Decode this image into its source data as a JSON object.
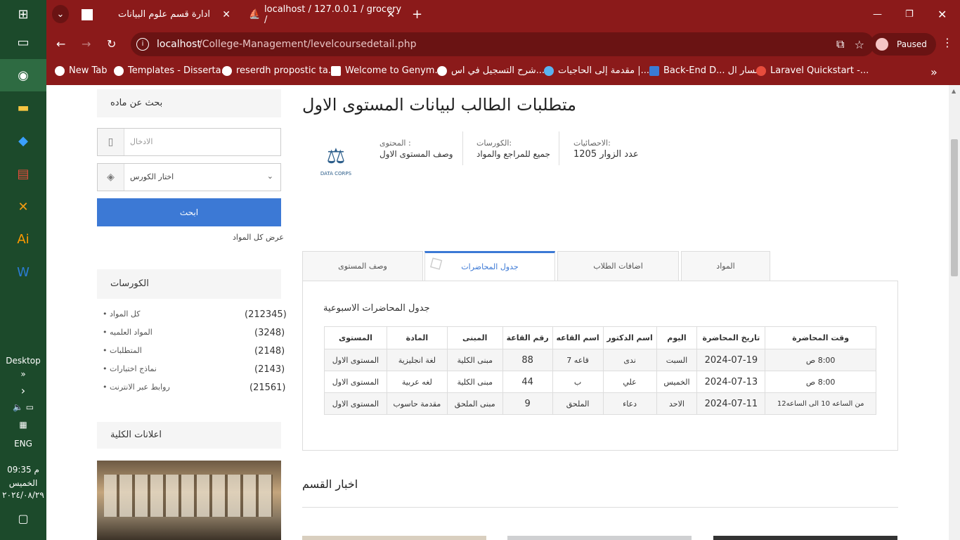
{
  "taskbar": {
    "desktop_label": "Desktop",
    "language": "ENG",
    "time": "09:35 م",
    "day": "الخميس",
    "date": "٢٠٢٤/٠٨/٢٩"
  },
  "browser": {
    "tabs": [
      {
        "title": "ادارة قسم علوم البيانات",
        "active": true
      },
      {
        "title": "localhost / 127.0.0.1 / grocery /",
        "active": false
      }
    ],
    "url_host": "localhost",
    "url_path": "/College-Management/levelcoursedetail.php",
    "profile_status": "Paused",
    "bookmarks": [
      "New Tab",
      "Templates - Disserta...",
      "reserdh propostic ta...",
      "Welcome to Genym...",
      "شرح التسجيل في اس...",
      "مقدمة إلى الحاجيات |...",
      "Back-End D... مسار ال",
      "Laravel Quickstart -..."
    ]
  },
  "sidebar": {
    "search_heading": "بحث عن ماده",
    "input_placeholder": "الادخال",
    "select_value": "اختار الكورس",
    "search_button": "ابحث",
    "show_all": "عرض كل المواد",
    "courses_heading": "الكورسات",
    "courses": [
      {
        "label": "كل المواد",
        "count": "(212345)"
      },
      {
        "label": "المواد العلميه",
        "count": "(3248)"
      },
      {
        "label": "المتطلبات",
        "count": "(2148)"
      },
      {
        "label": "نماذج اختبارات",
        "count": "(2143)"
      },
      {
        "label": "روابط عبر الانترنت",
        "count": "(21561)"
      }
    ],
    "announcements_heading": "اعلانات الكلية"
  },
  "main": {
    "title": "متطلبات الطالب لبيانات المستوى الاول",
    "logo_text": "DATA CORPS",
    "stats": [
      {
        "heading": "الاحصائيات:",
        "value": "عدد الزوار 1205"
      },
      {
        "heading": "الكورسات:",
        "value": "جميع للمراجع والمواد"
      },
      {
        "heading": "المحتوى :",
        "value": "وصف المستوى الاول"
      }
    ],
    "tabs": [
      "المواد",
      "اضافات الطلاب",
      "جدول المحاضرات",
      "وصف المستوى"
    ],
    "active_tab": "جدول المحاضرات",
    "schedule_title": "جدول المحاضرات الاسبوعية",
    "table_headers": [
      "وقت المحاضرة",
      "تاريخ المحاضرة",
      "اليوم",
      "اسم الدكتور",
      "اسم القاعه",
      "رقم القاعة",
      "المبنى",
      "المادة",
      "المستوى"
    ],
    "table_rows": [
      [
        "8:00 ص",
        "2024-07-19",
        "السبت",
        "ندى",
        "قاعه 7",
        "88",
        "مبنى الكلية",
        "لغة انجليزية",
        "المستوى الاول"
      ],
      [
        "8:00 ص",
        "2024-07-13",
        "الخميس",
        "علي",
        "ب",
        "44",
        "مبنى الكلية",
        "لغه عربية",
        "المستوى الاول"
      ],
      [
        "من الساعه 10 الى الساعه12",
        "2024-07-11",
        "الاحد",
        "دعاء",
        "الملحق",
        "9",
        "مبنى الملحق",
        "مقدمة حاسوب",
        "المستوى الاول"
      ]
    ],
    "news_heading": "اخبار القسم"
  }
}
